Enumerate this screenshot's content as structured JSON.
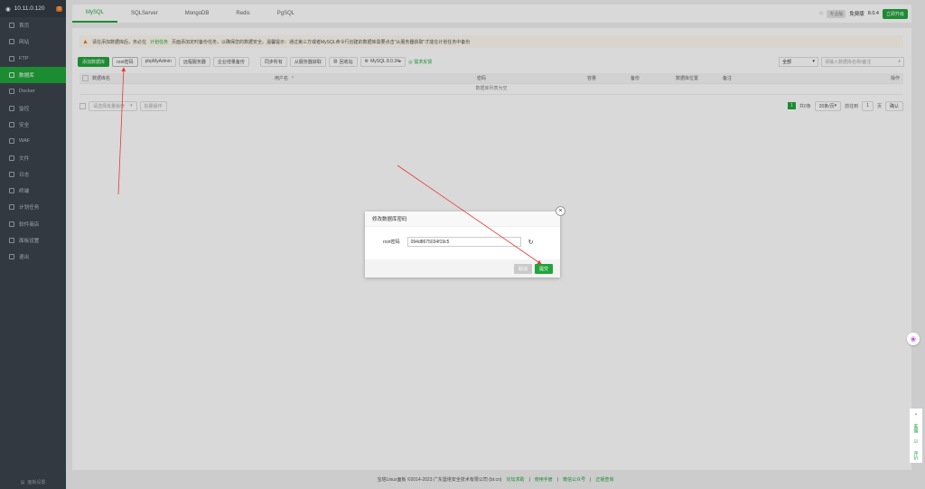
{
  "sidebar": {
    "server": "10.11.0.120",
    "badge": "0",
    "items": [
      {
        "label": "首页",
        "icon": "home-icon"
      },
      {
        "label": "网站",
        "icon": "globe-icon"
      },
      {
        "label": "FTP",
        "icon": "ftp-icon"
      },
      {
        "label": "数据库",
        "icon": "database-icon",
        "active": true
      },
      {
        "label": "Docker",
        "icon": "docker-icon"
      },
      {
        "label": "监控",
        "icon": "monitor-icon"
      },
      {
        "label": "安全",
        "icon": "shield-icon"
      },
      {
        "label": "WAF",
        "icon": "waf-icon"
      },
      {
        "label": "文件",
        "icon": "folder-icon"
      },
      {
        "label": "日志",
        "icon": "log-icon"
      },
      {
        "label": "终端",
        "icon": "terminal-icon"
      },
      {
        "label": "计划任务",
        "icon": "clock-icon"
      },
      {
        "label": "软件商店",
        "icon": "store-icon"
      },
      {
        "label": "面板设置",
        "icon": "gear-icon"
      },
      {
        "label": "退出",
        "icon": "logout-icon"
      }
    ],
    "bottom": "面板设置"
  },
  "tabs": [
    "MySQL",
    "SQLServer",
    "MongoDB",
    "Redis",
    "PgSQL"
  ],
  "topright": {
    "plan": "专业版",
    "label": "免费版",
    "version": "8.0.4",
    "upgrade": "立即升级"
  },
  "notice": {
    "prefix": "请在添加数据库后，务必在",
    "link": "计划任务",
    "suffix": "页面添加定时备份任务，以确保您的数据安全。温馨提示：通过第三方或者MySQL命令行创建的数据库需要点击\"从服务器获取\"才能在计划任务中备份"
  },
  "toolbar": {
    "add": "添加数据库",
    "root": "root密码",
    "pma": "phpMyAdmin",
    "remote": "远程服务器",
    "enterprise": "企业增量备份",
    "sync_all": "同步所有",
    "fetch": "从服务器获取",
    "recycle": "回收站",
    "mysql": "MySQL 8.0.34",
    "feedback": "需求反馈",
    "filter": "全部",
    "search_placeholder": "请输入数据库名称/备注"
  },
  "table": {
    "headers": [
      "数据库名",
      "用户名",
      "密码",
      "容量",
      "备份",
      "数据库位置",
      "备注",
      "操作"
    ],
    "empty": "数据库列表为空"
  },
  "footer_bar": {
    "batch": "请选择批量操作",
    "exec": "批量操作",
    "page": "1",
    "total": "共0条",
    "per_page": "20条/页",
    "jump": "前往到",
    "jump_page": "1",
    "unit": "页",
    "confirm": "确认"
  },
  "modal": {
    "title": "修改数据库密码",
    "label": "root密码",
    "value": "094d8675034f19c5",
    "cancel": "取消",
    "submit": "提交"
  },
  "footer": {
    "copyright": "宝塔Linux面板 ©2014-2023 广东堡塔安全技术有限公司 (bt.cn)",
    "links": [
      "论坛求助",
      "使用手册",
      "微信公众号",
      "正版查询"
    ]
  },
  "side_tools": [
    "客服",
    "评价"
  ]
}
